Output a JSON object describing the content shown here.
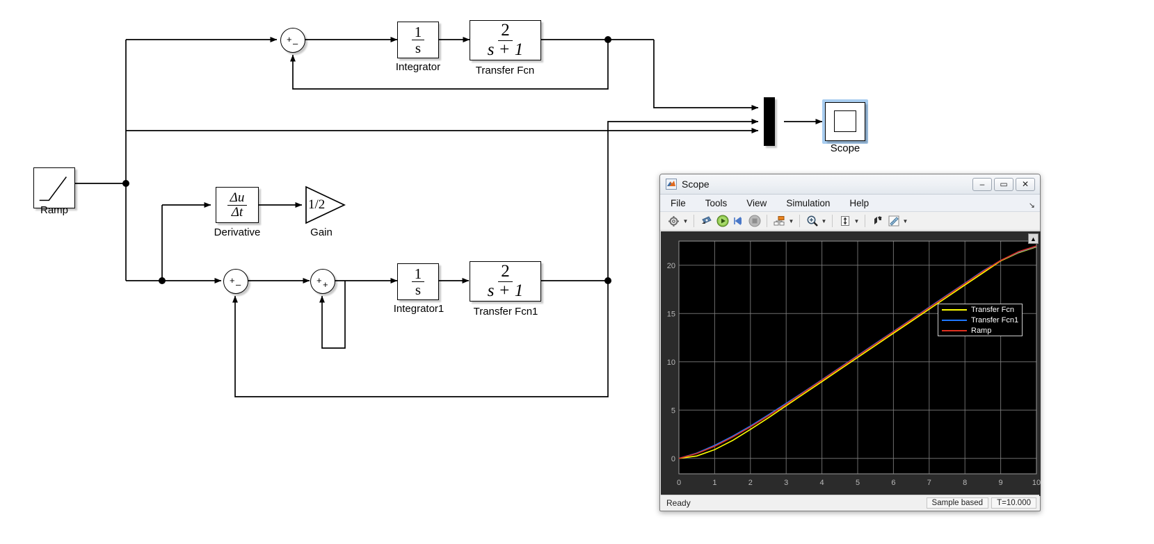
{
  "diagram": {
    "blocks": {
      "ramp": {
        "label": "Ramp",
        "icon": "ramp-icon"
      },
      "sum1": {
        "label": "",
        "signs": [
          "+",
          "–"
        ]
      },
      "integrator": {
        "label": "Integrator",
        "num": "1",
        "den": "s"
      },
      "transfer_fcn": {
        "label": "Transfer Fcn",
        "num": "2",
        "den": "s + 1"
      },
      "derivative": {
        "label": "Derivative",
        "num": "Δu",
        "den": "Δt"
      },
      "gain": {
        "label": "Gain",
        "value": "1/2"
      },
      "sum2": {
        "label": "",
        "signs": [
          "+",
          "–"
        ]
      },
      "sum3": {
        "label": "",
        "signs": [
          "+",
          "+"
        ]
      },
      "integrator1": {
        "label": "Integrator1",
        "num": "1",
        "den": "s"
      },
      "transfer_fcn1": {
        "label": "Transfer Fcn1",
        "num": "2",
        "den": "s + 1"
      },
      "mux": {
        "label": "",
        "icon": "mux-icon"
      },
      "scope": {
        "label": "Scope",
        "icon": "scope-icon",
        "selected": true
      }
    }
  },
  "scope_window": {
    "title": "Scope",
    "titlebar_buttons": [
      "–",
      "▭",
      "✕"
    ],
    "menus": [
      "File",
      "Tools",
      "View",
      "Simulation",
      "Help"
    ],
    "toolbar": [
      {
        "name": "configuration-properties-icon",
        "has_caret": true
      },
      {
        "name": "print-icon",
        "has_caret": false
      },
      {
        "name": "run-icon",
        "has_caret": false
      },
      {
        "name": "step-forward-icon",
        "has_caret": false
      },
      {
        "name": "stop-icon",
        "has_caret": false
      },
      {
        "name": "signal-selection-icon",
        "has_caret": true
      },
      {
        "name": "zoom-in-icon",
        "has_caret": true
      },
      {
        "name": "autoscale-icon",
        "has_caret": true
      },
      {
        "name": "style-icon",
        "has_caret": false
      },
      {
        "name": "measurements-icon",
        "has_caret": true
      }
    ],
    "status": {
      "ready": "Ready",
      "sample_mode": "Sample based",
      "time": "T=10.000"
    },
    "colors": {
      "trace_transfer_fcn": "#ffff00",
      "trace_transfer_fcn1": "#1f77ff",
      "trace_ramp": "#e03020",
      "plot_bg": "#000000",
      "grid": "#808080",
      "window_chrome": "#f0f0f0",
      "selection": "#a8cdf0"
    }
  },
  "chart_data": {
    "type": "line",
    "title": "",
    "xlabel": "",
    "ylabel": "",
    "xlim": [
      0,
      10
    ],
    "ylim": [
      -1.6,
      22.5
    ],
    "xticks": [
      "0",
      "1",
      "2",
      "3",
      "4",
      "5",
      "6",
      "7",
      "8",
      "9",
      "10"
    ],
    "yticks": [
      "0",
      "5",
      "10",
      "15",
      "20"
    ],
    "grid": true,
    "legend_position": "top-right",
    "legend": [
      "Transfer Fcn",
      "Transfer Fcn1",
      "Ramp"
    ],
    "x": [
      0,
      0.5,
      1,
      1.5,
      2,
      2.5,
      3,
      3.5,
      4,
      4.5,
      5,
      5.5,
      6,
      6.5,
      7,
      7.5,
      8,
      8.5,
      9,
      9.5,
      10
    ],
    "series": [
      {
        "name": "Transfer Fcn",
        "color": "#ffff00",
        "values": [
          0,
          0.25,
          0.9,
          1.85,
          3.0,
          4.2,
          5.45,
          6.7,
          7.95,
          9.2,
          10.45,
          11.7,
          12.95,
          14.2,
          15.45,
          16.7,
          17.95,
          19.2,
          20.45,
          21.3,
          21.9
        ]
      },
      {
        "name": "Transfer Fcn1",
        "color": "#1f77ff",
        "values": [
          0,
          0.55,
          1.35,
          2.3,
          3.35,
          4.5,
          5.7,
          6.9,
          8.15,
          9.4,
          10.65,
          11.9,
          13.15,
          14.4,
          15.65,
          16.9,
          18.15,
          19.4,
          20.5,
          21.35,
          21.95
        ]
      },
      {
        "name": "Ramp",
        "color": "#e03020",
        "values": [
          0,
          0.5,
          1.25,
          2.2,
          3.25,
          4.4,
          5.6,
          6.85,
          8.1,
          9.35,
          10.6,
          11.85,
          13.1,
          14.35,
          15.6,
          16.85,
          18.1,
          19.35,
          20.5,
          21.4,
          22.0
        ]
      }
    ]
  }
}
